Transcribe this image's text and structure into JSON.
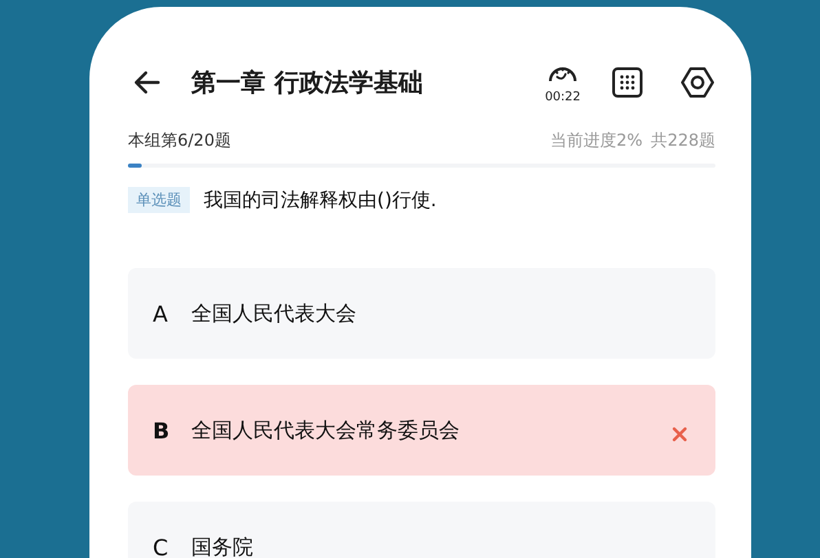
{
  "header": {
    "title": "第一章 行政法学基础",
    "timer": "00:22"
  },
  "progress": {
    "group": "本组第6/20题",
    "current": "当前进度2%",
    "total": "共228题",
    "level": 0.02
  },
  "question": {
    "type": "单选题",
    "text": "我国的司法解释权由()行使."
  },
  "options": [
    {
      "letter": "A",
      "text": "全国人民代表大会",
      "selected": false,
      "wrong": false
    },
    {
      "letter": "B",
      "text": "全国人民代表大会常务委员会",
      "selected": true,
      "wrong": true
    },
    {
      "letter": "C",
      "text": "国务院",
      "selected": false,
      "wrong": false
    }
  ]
}
